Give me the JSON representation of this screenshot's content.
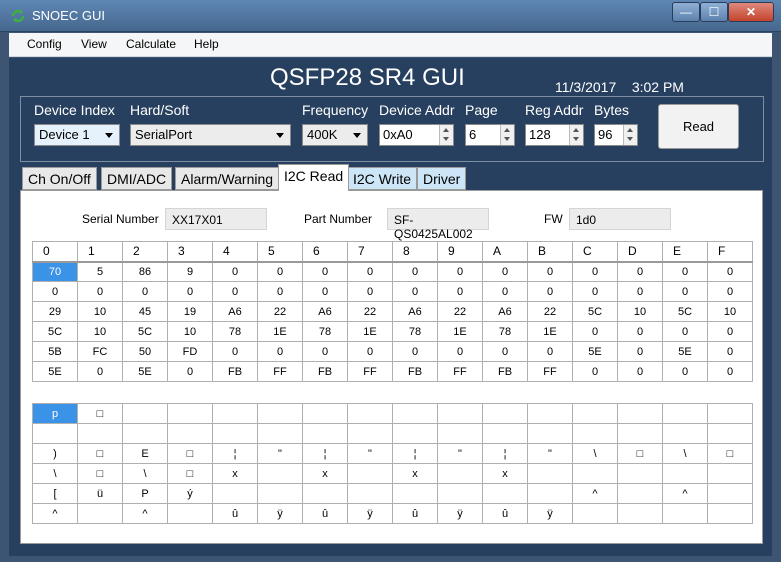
{
  "window": {
    "title": "SNOEC GUI",
    "min": "—",
    "max": "☐",
    "close": "✕"
  },
  "menu": [
    "Config",
    "View",
    "Calculate",
    "Help"
  ],
  "header": {
    "title": "QSFP28 SR4 GUI",
    "date": "11/3/2017",
    "time": "3:02 PM"
  },
  "controls": {
    "device_index": {
      "label": "Device Index",
      "value": "Device 1"
    },
    "hard_soft": {
      "label": "Hard/Soft",
      "value": "SerialPort"
    },
    "frequency": {
      "label": "Frequency",
      "value": "400K"
    },
    "device_addr": {
      "label": "Device Addr",
      "value": "0xA0"
    },
    "page": {
      "label": "Page",
      "value": "6"
    },
    "reg_addr": {
      "label": "Reg Addr",
      "value": "128"
    },
    "bytes": {
      "label": "Bytes",
      "value": "96"
    },
    "read_button": "Read"
  },
  "tabs": [
    "Ch On/Off",
    "DMI/ADC",
    "Alarm/Warning",
    "I2C Read",
    "I2C Write",
    "Driver"
  ],
  "info": {
    "serial_label": "Serial Number",
    "serial_value": "XX17X01",
    "part_label": "Part Number",
    "part_value": "SF-QS0425AL002",
    "fw_label": "FW",
    "fw_value": "1d0"
  },
  "hex_grid": {
    "headers": [
      "0",
      "1",
      "2",
      "3",
      "4",
      "5",
      "6",
      "7",
      "8",
      "9",
      "A",
      "B",
      "C",
      "D",
      "E",
      "F"
    ],
    "rows": [
      [
        "70",
        "5",
        "86",
        "9",
        "0",
        "0",
        "0",
        "0",
        "0",
        "0",
        "0",
        "0",
        "0",
        "0",
        "0",
        "0"
      ],
      [
        "0",
        "0",
        "0",
        "0",
        "0",
        "0",
        "0",
        "0",
        "0",
        "0",
        "0",
        "0",
        "0",
        "0",
        "0",
        "0"
      ],
      [
        "29",
        "10",
        "45",
        "19",
        "A6",
        "22",
        "A6",
        "22",
        "A6",
        "22",
        "A6",
        "22",
        "5C",
        "10",
        "5C",
        "10"
      ],
      [
        "5C",
        "10",
        "5C",
        "10",
        "78",
        "1E",
        "78",
        "1E",
        "78",
        "1E",
        "78",
        "1E",
        "0",
        "0",
        "0",
        "0"
      ],
      [
        "5B",
        "FC",
        "50",
        "FD",
        "0",
        "0",
        "0",
        "0",
        "0",
        "0",
        "0",
        "0",
        "5E",
        "0",
        "5E",
        "0"
      ],
      [
        "5E",
        "0",
        "5E",
        "0",
        "FB",
        "FF",
        "FB",
        "FF",
        "FB",
        "FF",
        "FB",
        "FF",
        "0",
        "0",
        "0",
        "0"
      ]
    ]
  },
  "ascii_grid": {
    "rows": [
      [
        "p",
        "□",
        "",
        "",
        "",
        "",
        "",
        "",
        "",
        "",
        "",
        "",
        "",
        "",
        "",
        ""
      ],
      [
        "",
        "",
        "",
        "",
        "",
        "",
        "",
        "",
        "",
        "",
        "",
        "",
        "",
        "",
        "",
        ""
      ],
      [
        ")",
        "□",
        "E",
        "□",
        "¦",
        "\"",
        "¦",
        "\"",
        "¦",
        "\"",
        "¦",
        "\"",
        "\\",
        "□",
        "\\",
        "□"
      ],
      [
        "\\",
        "□",
        "\\",
        "□",
        "x",
        "",
        "x",
        "",
        "x",
        "",
        "x",
        "",
        "",
        "",
        "",
        ""
      ],
      [
        "[",
        "ü",
        "P",
        "ý",
        "",
        "",
        "",
        "",
        "",
        "",
        "",
        "",
        "^",
        "",
        "^",
        ""
      ],
      [
        "^",
        "",
        "^",
        "",
        "û",
        "ÿ",
        "û",
        "ÿ",
        "û",
        "ÿ",
        "û",
        "ÿ",
        "",
        "",
        "",
        ""
      ]
    ]
  }
}
